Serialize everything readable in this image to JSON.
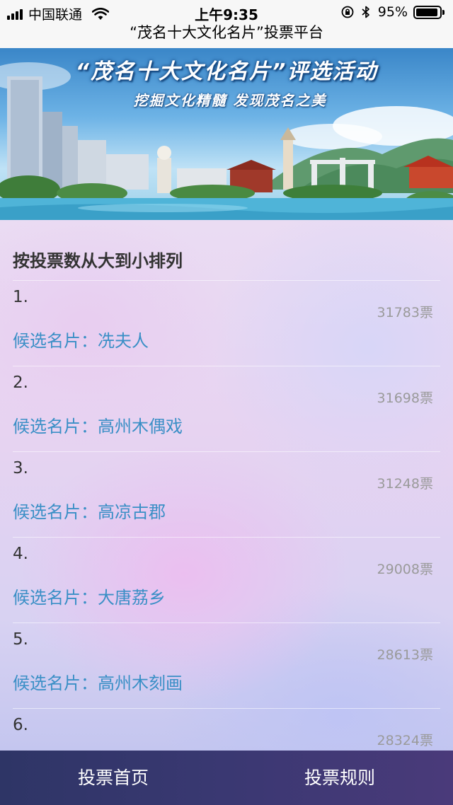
{
  "status_bar": {
    "carrier": "中国联通",
    "time": "上午9:35",
    "battery": "95%",
    "battery_level": 0.95,
    "icons": [
      "signal-icon",
      "wifi-icon",
      "orientation-lock-icon",
      "bluetooth-icon",
      "battery-icon"
    ]
  },
  "nav": {
    "title": "“茂名十大文化名片”投票平台"
  },
  "banner": {
    "title": "“茂名十大文化名片”评选活动",
    "subtitle": "挖掘文化精髓  发现茂名之美"
  },
  "list": {
    "heading": "按投票数从大到小排列",
    "items": [
      {
        "rank": "1.",
        "votes": "31783票",
        "name": "候选名片：冼夫人"
      },
      {
        "rank": "2.",
        "votes": "31698票",
        "name": "候选名片：高州木偶戏"
      },
      {
        "rank": "3.",
        "votes": "31248票",
        "name": "候选名片：高凉古郡"
      },
      {
        "rank": "4.",
        "votes": "29008票",
        "name": "候选名片：大唐荔乡"
      },
      {
        "rank": "5.",
        "votes": "28613票",
        "name": "候选名片：高州木刻画"
      },
      {
        "rank": "6.",
        "votes": "28324票",
        "name": ""
      }
    ]
  },
  "tabs": [
    {
      "label": "投票首页"
    },
    {
      "label": "投票规则"
    }
  ],
  "colors": {
    "candidate_name": "#3a8fc6",
    "vote_count": "#9a9a9a",
    "tab_bar": "#3a3872"
  }
}
